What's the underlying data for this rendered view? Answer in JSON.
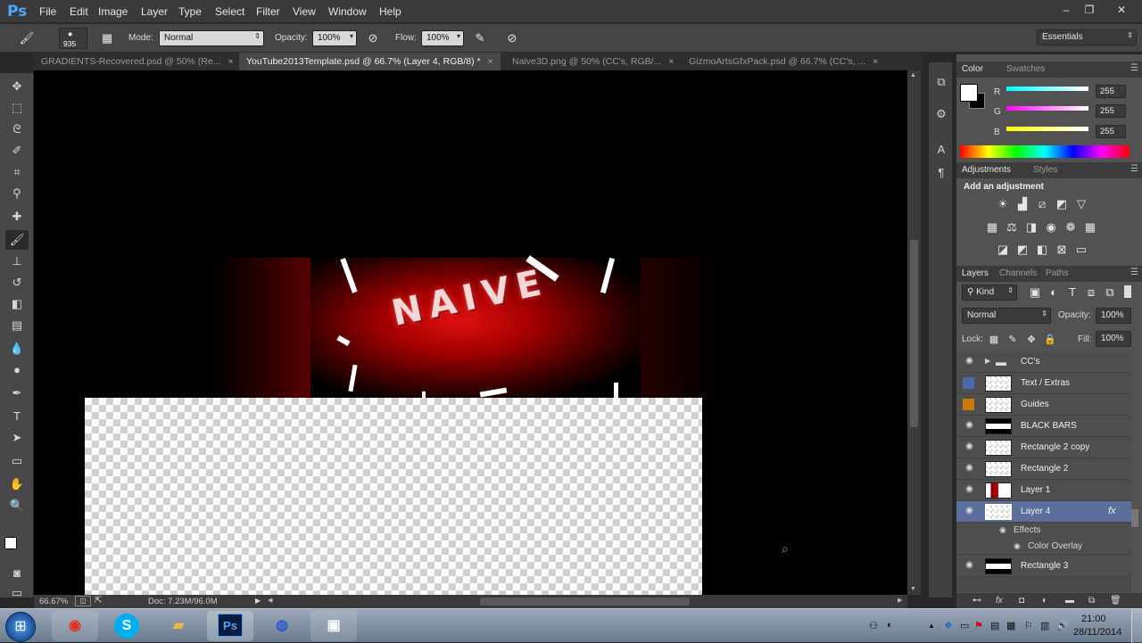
{
  "app": {
    "logo": "Ps"
  },
  "menu": {
    "items": [
      "File",
      "Edit",
      "Image",
      "Layer",
      "Type",
      "Select",
      "Filter",
      "View",
      "Window",
      "Help"
    ]
  },
  "window_controls": {
    "minimize": "–",
    "restore": "❐",
    "close": "✕"
  },
  "options": {
    "brush_size": "935",
    "mode_label": "Mode:",
    "mode_value": "Normal",
    "opacity_label": "Opacity:",
    "opacity_value": "100%",
    "flow_label": "Flow:",
    "flow_value": "100%",
    "workspace": "Essentials"
  },
  "tabs": [
    {
      "label": "GRADIENTS-Recovered.psd @ 50% (Re...",
      "close": "×"
    },
    {
      "label": "YouTube2013Template.psd @ 66.7% (Layer 4, RGB/8) *",
      "close": "×"
    },
    {
      "label": "Naive3D.png @ 50% (CC's, RGB/...",
      "close": "×"
    },
    {
      "label": "GizmoArtsGfxPack.psd @ 66.7% (CC's, ...",
      "close": "×"
    }
  ],
  "canvas": {
    "logo_text": "NAIVE"
  },
  "status": {
    "zoom": "66.67%",
    "doc": "Doc: 7.23M/96.0M"
  },
  "color_panel": {
    "tabs": [
      "Color",
      "Swatches"
    ],
    "r_label": "R",
    "r_value": "255",
    "g_label": "G",
    "g_value": "255",
    "b_label": "B",
    "b_value": "255"
  },
  "adjustments_panel": {
    "tabs": [
      "Adjustments",
      "Styles"
    ],
    "heading": "Add an adjustment"
  },
  "layers_panel": {
    "tabs": [
      "Layers",
      "Channels",
      "Paths"
    ],
    "kind_label": "Kind",
    "blend_mode": "Normal",
    "opacity_label": "Opacity:",
    "opacity_value": "100%",
    "lock_label": "Lock:",
    "fill_label": "Fill:",
    "fill_value": "100%",
    "layers": [
      {
        "name": "CC's"
      },
      {
        "name": "Text / Extras"
      },
      {
        "name": "Guides"
      },
      {
        "name": "BLACK BARS"
      },
      {
        "name": "Rectangle 2 copy"
      },
      {
        "name": "Rectangle 2"
      },
      {
        "name": "Layer 1"
      },
      {
        "name": "Layer 4",
        "fx": "fx"
      },
      {
        "name": "Rectangle 3"
      }
    ],
    "effects_label": "Effects",
    "color_overlay_label": "Color Overlay"
  },
  "taskbar": {
    "time": "21:00",
    "date": "28/11/2014",
    "apps": [
      "chrome",
      "skype",
      "explorer",
      "photoshop",
      "cinema4d",
      "media"
    ]
  },
  "colors": {
    "accent_blue": "#5b6f9c",
    "ps_blue": "#4aa8ff",
    "guides_orange": "#c97b0a",
    "text_extras_blue": "#4a6aa8"
  }
}
